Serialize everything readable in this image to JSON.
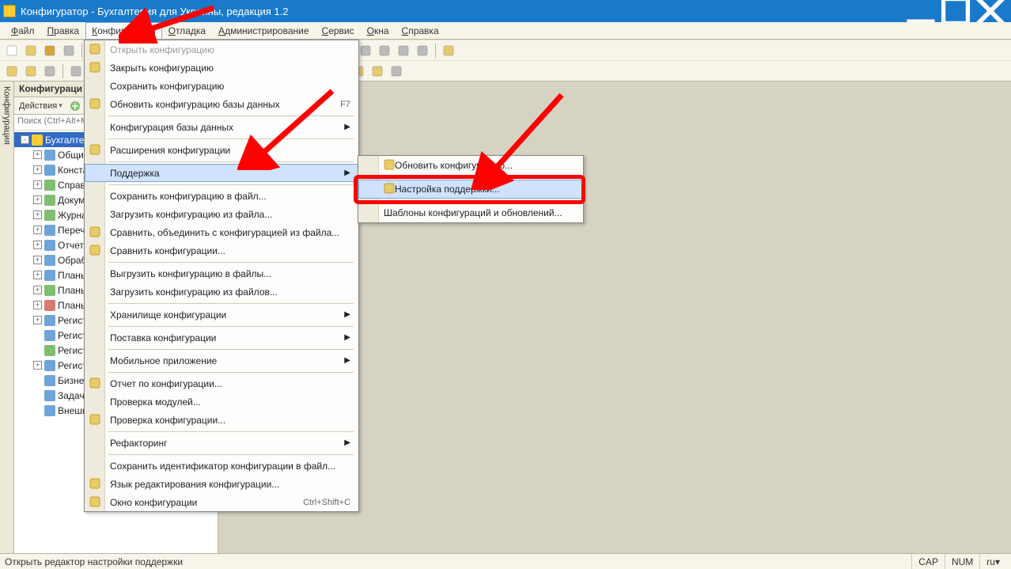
{
  "title": "Конфигуратор - Бухгалтерия для Украины, редакция 1.2",
  "menubar": [
    "Файл",
    "Правка",
    "Конфигурация",
    "Отладка",
    "Администрирование",
    "Сервис",
    "Окна",
    "Справка"
  ],
  "menubar_active_index": 2,
  "sidebar_tab": "Конфигурация",
  "tree_panel": {
    "title": "Конфигураци",
    "actions_label": "Действия",
    "search_placeholder": "Поиск (Ctrl+Alt+M)"
  },
  "tree": [
    {
      "label": "Бухгалтерия",
      "selected": true,
      "icon": "root",
      "exp": "-"
    },
    {
      "label": "Общие",
      "icon": "blue",
      "exp": "+"
    },
    {
      "label": "Конста",
      "icon": "blue",
      "exp": "+"
    },
    {
      "label": "Справо",
      "icon": "green",
      "exp": "+"
    },
    {
      "label": "Докуме",
      "icon": "green",
      "exp": "+"
    },
    {
      "label": "Журна",
      "icon": "green",
      "exp": "+"
    },
    {
      "label": "Перечи",
      "icon": "blue",
      "exp": "+"
    },
    {
      "label": "Отчеты",
      "icon": "blue",
      "exp": "+"
    },
    {
      "label": "Обрабо",
      "icon": "blue",
      "exp": "+"
    },
    {
      "label": "Планы",
      "icon": "blue",
      "exp": "+"
    },
    {
      "label": "Планы",
      "icon": "green",
      "exp": "+"
    },
    {
      "label": "Планы",
      "icon": "red",
      "exp": "+"
    },
    {
      "label": "Регист",
      "icon": "blue",
      "exp": "+"
    },
    {
      "label": "Регист",
      "icon": "blue",
      "exp": " "
    },
    {
      "label": "Регист",
      "icon": "green",
      "exp": " "
    },
    {
      "label": "Регист",
      "icon": "blue",
      "exp": "+"
    },
    {
      "label": "Бизнес",
      "icon": "blue",
      "exp": " "
    },
    {
      "label": "Задачи",
      "icon": "blue",
      "exp": " "
    },
    {
      "label": "Внешн",
      "icon": "blue",
      "exp": " "
    }
  ],
  "dropdown": [
    {
      "t": "item",
      "label": "Открыть конфигурацию",
      "disabled": true,
      "icon": "open"
    },
    {
      "t": "item",
      "label": "Закрыть конфигурацию",
      "icon": "close-cfg"
    },
    {
      "t": "item",
      "label": "Сохранить конфигурацию"
    },
    {
      "t": "item",
      "label": "Обновить конфигурацию базы данных",
      "shortcut": "F7",
      "icon": "db"
    },
    {
      "t": "sep"
    },
    {
      "t": "item",
      "label": "Конфигурация базы данных",
      "arrow": true
    },
    {
      "t": "sep"
    },
    {
      "t": "item",
      "label": "Расширения конфигурации",
      "icon": "ext"
    },
    {
      "t": "sep"
    },
    {
      "t": "item",
      "label": "Поддержка",
      "arrow": true,
      "hover": true
    },
    {
      "t": "sep"
    },
    {
      "t": "item",
      "label": "Сохранить конфигурацию в файл..."
    },
    {
      "t": "item",
      "label": "Загрузить конфигурацию из файла..."
    },
    {
      "t": "item",
      "label": "Сравнить, объединить с конфигурацией из файла...",
      "icon": "cmp"
    },
    {
      "t": "item",
      "label": "Сравнить конфигурации...",
      "icon": "cmp2"
    },
    {
      "t": "sep"
    },
    {
      "t": "item",
      "label": "Выгрузить конфигурацию в файлы..."
    },
    {
      "t": "item",
      "label": "Загрузить конфигурацию из файлов..."
    },
    {
      "t": "sep"
    },
    {
      "t": "item",
      "label": "Хранилище конфигурации",
      "arrow": true
    },
    {
      "t": "sep"
    },
    {
      "t": "item",
      "label": "Поставка конфигурации",
      "arrow": true
    },
    {
      "t": "sep"
    },
    {
      "t": "item",
      "label": "Мобильное приложение",
      "arrow": true
    },
    {
      "t": "sep"
    },
    {
      "t": "item",
      "label": "Отчет по конфигурации...",
      "icon": "rep"
    },
    {
      "t": "item",
      "label": "Проверка модулей..."
    },
    {
      "t": "item",
      "label": "Проверка конфигурации...",
      "icon": "chk"
    },
    {
      "t": "sep"
    },
    {
      "t": "item",
      "label": "Рефакторинг",
      "arrow": true
    },
    {
      "t": "sep"
    },
    {
      "t": "item",
      "label": "Сохранить идентификатор конфигурации в файл..."
    },
    {
      "t": "item",
      "label": "Язык редактирования конфигурации...",
      "icon": "abc"
    },
    {
      "t": "item",
      "label": "Окно конфигурации",
      "shortcut": "Ctrl+Shift+C",
      "icon": "win"
    }
  ],
  "submenu": [
    {
      "t": "item",
      "label": "Обновить конфигурацию...",
      "icon": "upd"
    },
    {
      "t": "sep"
    },
    {
      "t": "item",
      "label": "Настройка поддержки...",
      "icon": "sup",
      "hover": true
    },
    {
      "t": "sep"
    },
    {
      "t": "item",
      "label": "Шаблоны конфигураций и обновлений..."
    }
  ],
  "statusbar": {
    "hint": "Открыть редактор настройки поддержки",
    "cap": "CAP",
    "num": "NUM",
    "lang": "ru"
  }
}
